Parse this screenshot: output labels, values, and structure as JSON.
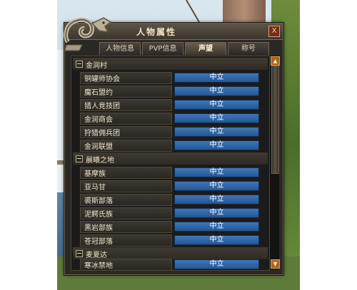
{
  "window": {
    "title": "人物属性",
    "close_label": "X"
  },
  "tabs": [
    {
      "label": "人物信息",
      "active": false
    },
    {
      "label": "PVP信息",
      "active": false
    },
    {
      "label": "声望",
      "active": true
    },
    {
      "label": "称号",
      "active": false
    }
  ],
  "categories": [
    {
      "label": "金润村",
      "items": [
        {
          "label": "铜罐师协会",
          "status": "中立"
        },
        {
          "label": "魔石盟约",
          "status": "中立"
        },
        {
          "label": "猎人竞技团",
          "status": "中立"
        },
        {
          "label": "金润商会",
          "status": "中立"
        },
        {
          "label": "狩猎佣兵团",
          "status": "中立"
        },
        {
          "label": "金润联盟",
          "status": "中立"
        }
      ]
    },
    {
      "label": "晨曦之地",
      "items": [
        {
          "label": "基摩族",
          "status": "中立"
        },
        {
          "label": "亚马甘",
          "status": "中立"
        },
        {
          "label": "裘斯部落",
          "status": "中立"
        },
        {
          "label": "泥鳄氏族",
          "status": "中立"
        },
        {
          "label": "黑岩部族",
          "status": "中立"
        },
        {
          "label": "苍冠部落",
          "status": "中立"
        }
      ]
    },
    {
      "label": "麦夏达",
      "items": [
        {
          "label": "寒冰禁地",
          "status": "中立"
        }
      ]
    }
  ],
  "icons": {
    "scroll_up": "up-arrow-icon",
    "scroll_down": "down-arrow-icon",
    "emblem": "dragon-emblem-icon",
    "collapse": "collapse-icon"
  },
  "colors": {
    "bar": "#2f62a6",
    "frame": "#2a2825",
    "accent": "#a7631f"
  }
}
